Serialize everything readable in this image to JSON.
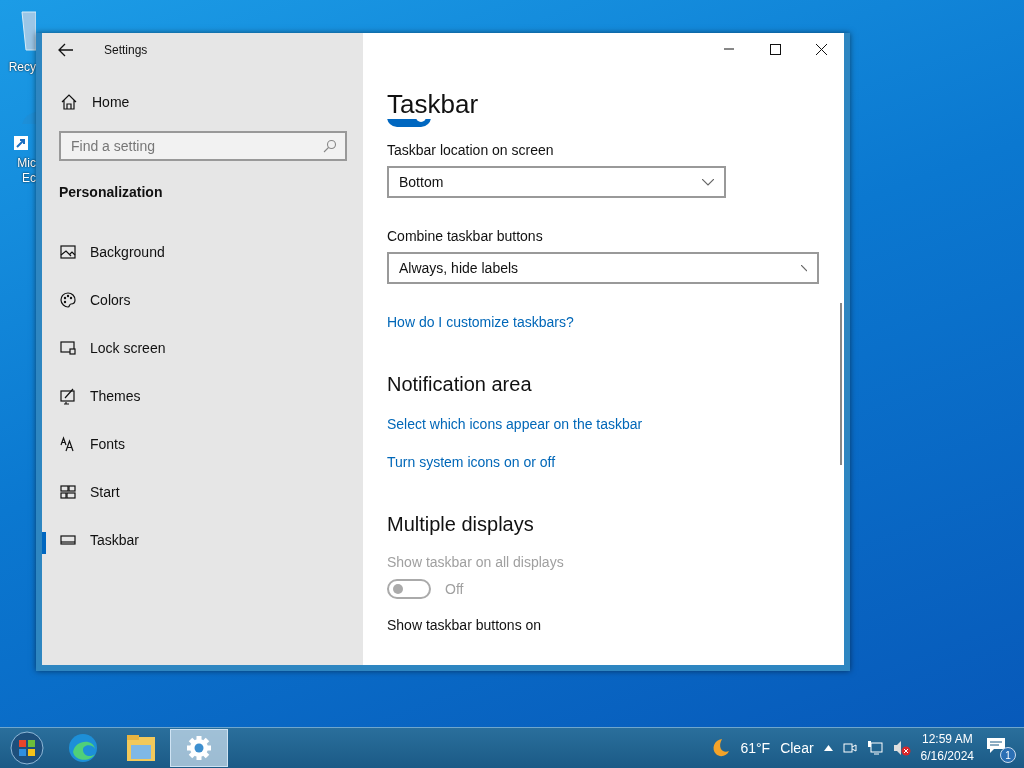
{
  "desktop_icons": [
    {
      "label_lines": [
        "Recy"
      ]
    },
    {
      "label_lines": [
        "Mic",
        "Ec"
      ]
    }
  ],
  "window": {
    "title": "Settings"
  },
  "sidebar": {
    "home": "Home",
    "search": {
      "placeholder": "Find a setting"
    },
    "section": "Personalization",
    "items": [
      {
        "label": "Background",
        "selected": false
      },
      {
        "label": "Colors",
        "selected": false
      },
      {
        "label": "Lock screen",
        "selected": false
      },
      {
        "label": "Themes",
        "selected": false
      },
      {
        "label": "Fonts",
        "selected": false
      },
      {
        "label": "Start",
        "selected": false
      },
      {
        "label": "Taskbar",
        "selected": true
      }
    ]
  },
  "content": {
    "title": "Taskbar",
    "top_toggle": {
      "on": true
    },
    "location": {
      "label": "Taskbar location on screen",
      "value": "Bottom"
    },
    "combine": {
      "label": "Combine taskbar buttons",
      "value": "Always, hide labels"
    },
    "help_link": "How do I customize taskbars?",
    "notification_area": {
      "heading": "Notification area",
      "links": [
        "Select which icons appear on the taskbar",
        "Turn system icons on or off"
      ]
    },
    "multiple_displays": {
      "heading": "Multiple displays",
      "toggle": {
        "label": "Show taskbar on all displays",
        "state": "Off",
        "on": false,
        "disabled": true
      },
      "next_label": "Show taskbar buttons on"
    }
  },
  "taskbar": {
    "apps": [
      {
        "selected": false
      },
      {
        "selected": false
      },
      {
        "selected": true
      }
    ],
    "tray": {
      "temperature": "61°F",
      "weather": "Clear",
      "time": "12:59 AM",
      "date": "6/16/2024",
      "notifications": "1"
    }
  }
}
